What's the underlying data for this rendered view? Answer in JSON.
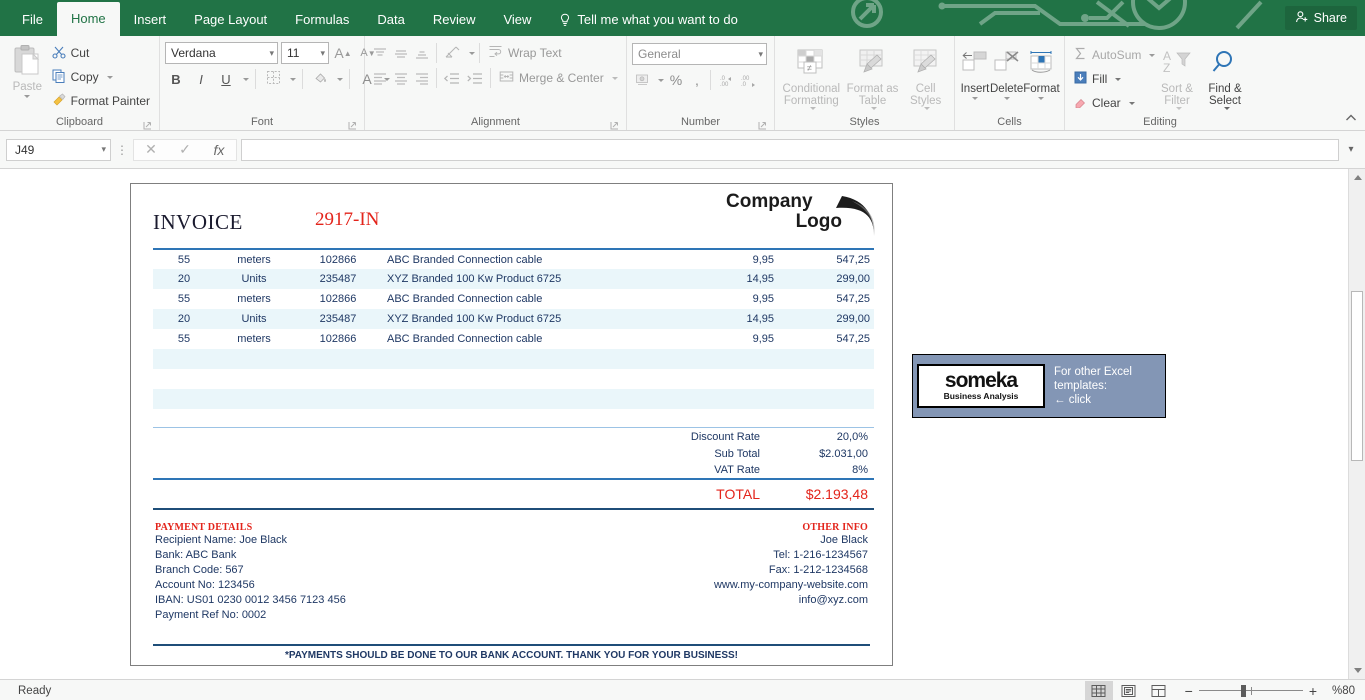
{
  "titlebar": {
    "tabs": [
      {
        "label": "File",
        "active": false
      },
      {
        "label": "Home",
        "active": true
      },
      {
        "label": "Insert",
        "active": false
      },
      {
        "label": "Page Layout",
        "active": false
      },
      {
        "label": "Formulas",
        "active": false
      },
      {
        "label": "Data",
        "active": false
      },
      {
        "label": "Review",
        "active": false
      },
      {
        "label": "View",
        "active": false
      }
    ],
    "tell_me": "Tell me what you want to do",
    "tell_me_icon": "lightbulb-icon",
    "share_label": "Share",
    "share_icon": "person-add-icon",
    "accent_color": "#217346"
  },
  "ribbon": {
    "clipboard": {
      "name": "Clipboard",
      "paste": "Paste",
      "cut": "Cut",
      "copy": "Copy",
      "format_painter": "Format Painter"
    },
    "font": {
      "name": "Font",
      "font_family": "Verdana",
      "font_size": "11",
      "grow_font": "A",
      "shrink_font": "A",
      "bold": "B",
      "italic": "I",
      "underline": "U",
      "borders_icon": "borders-icon",
      "fill_color_icon": "fill-color-icon",
      "font_color": "A"
    },
    "alignment": {
      "name": "Alignment",
      "wrap_text": "Wrap Text",
      "merge_center": "Merge & Center",
      "orientation_icon": "text-orientation-icon"
    },
    "number": {
      "name": "Number",
      "format": "General",
      "percent": "%",
      "comma": ",",
      "increase_decimal": ".00",
      "decrease_decimal": ".00"
    },
    "styles": {
      "name": "Styles",
      "conditional_formatting": "Conditional Formatting",
      "format_as_table": "Format as Table",
      "cell_styles": "Cell Styles"
    },
    "cells": {
      "name": "Cells",
      "insert": "Insert",
      "delete": "Delete",
      "format": "Format"
    },
    "editing": {
      "name": "Editing",
      "autosum": "AutoSum",
      "fill": "Fill",
      "clear": "Clear",
      "sort_filter": "Sort & Filter",
      "find_select": "Find & Select"
    },
    "collapse_icon": "chevron-up-icon"
  },
  "formula_bar": {
    "name_box": "J49",
    "cancel_icon": "cancel-icon",
    "enter_icon": "check-icon",
    "function_icon": "fx-icon",
    "formula_value": "",
    "formula_placeholder": "",
    "expand_icon": "chevron-down-icon"
  },
  "invoice": {
    "title": "INVOICE",
    "number": "2917-IN",
    "logo": {
      "line1": "Company",
      "line2": "Logo"
    },
    "items": [
      {
        "qty": "55",
        "unit": "meters",
        "code": "102866",
        "desc": "ABC Branded Connection cable",
        "price": "9,95",
        "amount": "547,25"
      },
      {
        "qty": "20",
        "unit": "Units",
        "code": "235487",
        "desc": "XYZ Branded 100 Kw Product 6725",
        "price": "14,95",
        "amount": "299,00"
      },
      {
        "qty": "55",
        "unit": "meters",
        "code": "102866",
        "desc": "ABC Branded Connection cable",
        "price": "9,95",
        "amount": "547,25"
      },
      {
        "qty": "20",
        "unit": "Units",
        "code": "235487",
        "desc": "XYZ Branded 100 Kw Product 6725",
        "price": "14,95",
        "amount": "299,00"
      },
      {
        "qty": "55",
        "unit": "meters",
        "code": "102866",
        "desc": "ABC Branded Connection cable",
        "price": "9,95",
        "amount": "547,25"
      },
      {
        "qty": "",
        "unit": "",
        "code": "",
        "desc": "",
        "price": "",
        "amount": ""
      },
      {
        "qty": "",
        "unit": "",
        "code": "",
        "desc": "",
        "price": "",
        "amount": ""
      },
      {
        "qty": "",
        "unit": "",
        "code": "",
        "desc": "",
        "price": "",
        "amount": ""
      },
      {
        "qty": "",
        "unit": "",
        "code": "",
        "desc": "",
        "price": "",
        "amount": ""
      }
    ],
    "totals": {
      "discount_rate_label": "Discount Rate",
      "discount_rate_value": "20,0%",
      "sub_total_label": "Sub Total",
      "sub_total_value": "$2.031,00",
      "vat_rate_label": "VAT Rate",
      "vat_rate_value": "8%",
      "total_label": "TOTAL",
      "total_value": "$2.193,48"
    },
    "payment_details": {
      "heading": "PAYMENT DETAILS",
      "lines": [
        "Recipient Name: Joe Black",
        "Bank: ABC Bank",
        "Branch Code: 567",
        "Account No: 123456",
        "IBAN: US01 0230 0012 3456 7123 456",
        "Payment Ref No: 0002"
      ]
    },
    "other_info": {
      "heading": "OTHER INFO",
      "lines": [
        "Joe Black",
        "Tel: 1-216-1234567",
        "Fax: 1-212-1234568",
        "www.my-company-website.com",
        "info@xyz.com"
      ]
    },
    "footnote": "*PAYMENTS SHOULD BE DONE TO OUR BANK ACCOUNT. THANK YOU FOR YOUR BUSINESS!",
    "colors": {
      "text": "#1f3864",
      "accent": "#e3241b",
      "rule": "#2e75b6",
      "alt_row": "#eaf6fa"
    }
  },
  "someka_banner": {
    "brand": "someka",
    "tagline": "Business Analysis",
    "text_line1": "For other Excel",
    "text_line2": "templates:",
    "text_line3": "← click",
    "bg_color": "#8396b5"
  },
  "status_bar": {
    "status": "Ready",
    "view_normal_icon": "normal-view-icon",
    "view_page_layout_icon": "page-layout-view-icon",
    "view_page_break_icon": "page-break-view-icon",
    "zoom_out": "−",
    "zoom_in": "+",
    "zoom_level": "%80"
  },
  "scrollbar": {
    "up_icon": "scroll-up-icon",
    "down_icon": "scroll-down-icon",
    "thumb": "vertical-scroll-thumb"
  }
}
